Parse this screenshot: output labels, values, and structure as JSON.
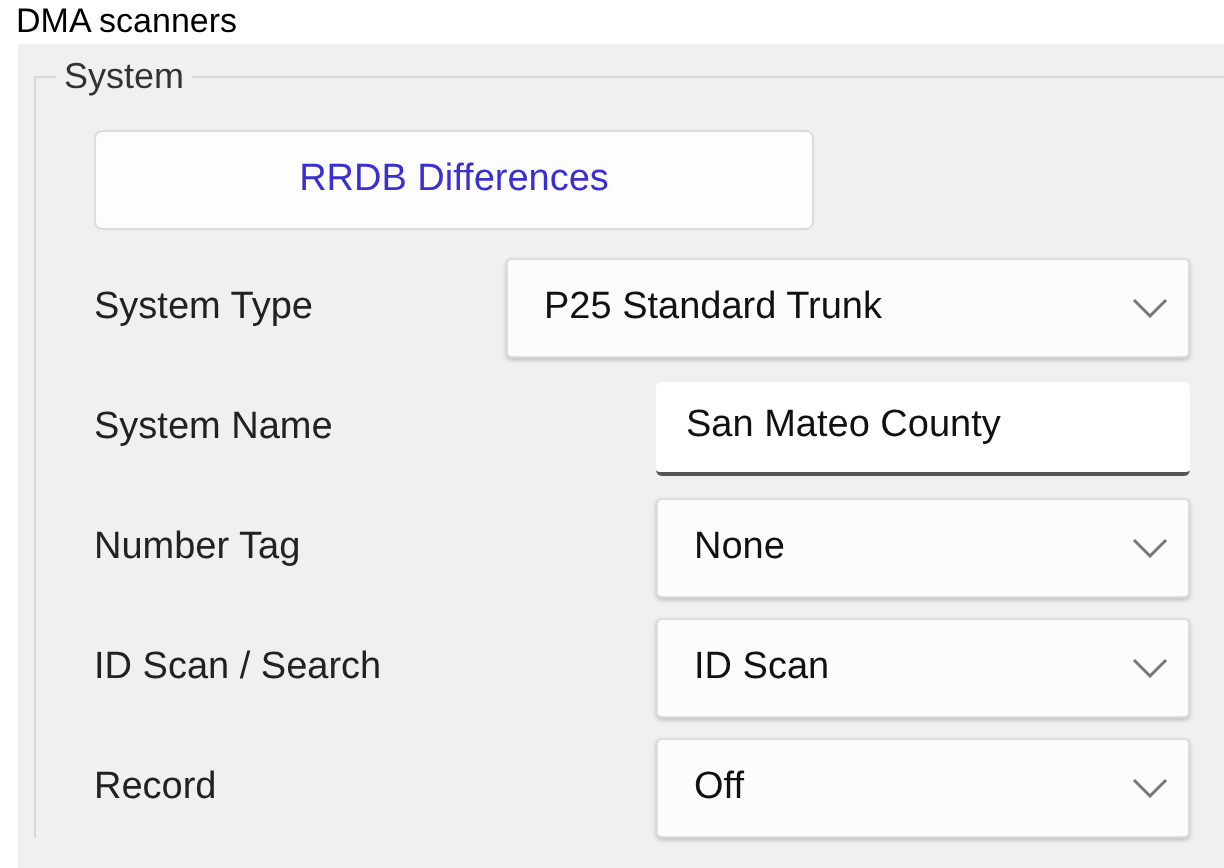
{
  "heading": "DMA scanners",
  "group": {
    "title": "System",
    "button": "RRDB Differences",
    "fields": [
      {
        "kind": "combo",
        "label": "System Type",
        "value": "P25 Standard Trunk"
      },
      {
        "kind": "text",
        "label": "System Name",
        "value": "San Mateo County"
      },
      {
        "kind": "combo",
        "label": "Number Tag",
        "value": "None"
      },
      {
        "kind": "combo",
        "label": "ID Scan / Search",
        "value": "ID Scan"
      },
      {
        "kind": "combo",
        "label": "Record",
        "value": "Off"
      }
    ]
  }
}
